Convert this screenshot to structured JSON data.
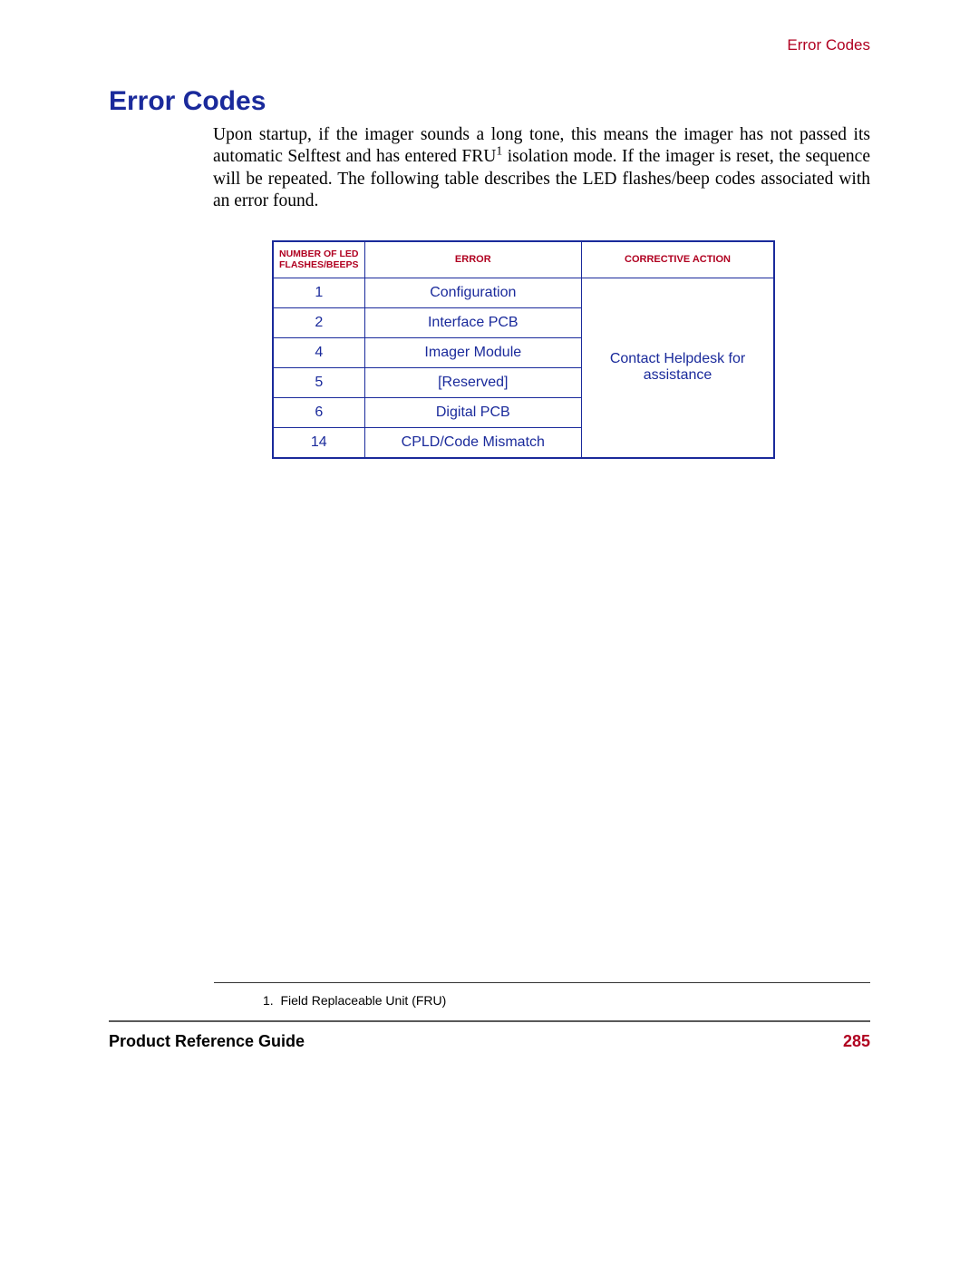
{
  "header": {
    "section_label": "Error Codes"
  },
  "title": "Error Codes",
  "paragraph": {
    "pre_sup": "Upon startup, if the imager sounds a long tone, this means the imager has not passed its automatic Selftest and has entered FRU",
    "sup": "1",
    "post_sup": " isolation mode. If the imager is reset, the sequence will be repeated. The following table describes the LED flashes/beep codes associated with an error found."
  },
  "table": {
    "headers": {
      "col1_line1": "Number of LED",
      "col1_line2": "Flashes/Beeps",
      "col2": "Error",
      "col3": "Corrective Action"
    },
    "rows": [
      {
        "num": "1",
        "error": "Configuration"
      },
      {
        "num": "2",
        "error": "Interface PCB"
      },
      {
        "num": "4",
        "error": "Imager Module"
      },
      {
        "num": "5",
        "error": "[Reserved]"
      },
      {
        "num": "6",
        "error": "Digital PCB"
      },
      {
        "num": "14",
        "error": "CPLD/Code Mismatch"
      }
    ],
    "action_merged": "Contact Helpdesk for assistance"
  },
  "footnote": {
    "marker": "1.",
    "text": "Field Replaceable Unit (FRU)"
  },
  "footer": {
    "guide": "Product Reference Guide",
    "page": "285"
  }
}
